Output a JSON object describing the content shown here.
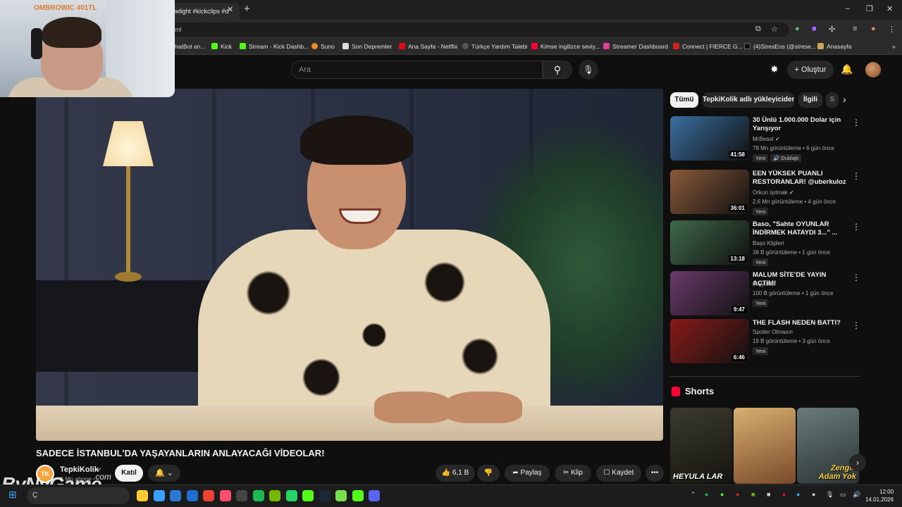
{
  "browser": {
    "tab_title": "wlight #kickclips #d",
    "tab_close": "✕",
    "new_tab": "+",
    "address": "ml",
    "window_controls": [
      "–",
      "❐",
      "✕"
    ],
    "bookmarks": [
      {
        "label": "hatBot an...",
        "color": "#444444"
      },
      {
        "label": "Kick",
        "color": "#53fc18"
      },
      {
        "label": "Stream - Kick Dashb...",
        "color": "#53fc18"
      },
      {
        "label": "Suno",
        "color": "#f08a24"
      },
      {
        "label": "Son Depremler",
        "color": "#dddddd"
      },
      {
        "label": "Ana Sayfa - Netflix",
        "color": "#e50914"
      },
      {
        "label": "Türkçe Yardım Talebi",
        "color": "#222222"
      },
      {
        "label": "Kimse ingilizce seviy...",
        "color": "#ff0033"
      },
      {
        "label": "Streamer Dashboard",
        "color": "#e0409a"
      },
      {
        "label": "Connect | FIERCE G...",
        "color": "#d4231f"
      },
      {
        "label": "(4)StresEos (@strese...",
        "color": "#111111"
      },
      {
        "label": "Anasayfa",
        "color": "#c8a85a"
      }
    ]
  },
  "webcam": {
    "label": "OMBROWIC 401TL"
  },
  "header": {
    "search_placeholder": "Ara",
    "search_icon": "search-icon",
    "mic_icon": "mic-icon",
    "create_label": "Oluştur",
    "create_icon": "+"
  },
  "video": {
    "title": "SADECE İSTANBUL'DA YAŞAYANLARIN ANLAYACAĞI VİDEOLAR!",
    "channel_name": "TepkiKolik",
    "channel_avatar_text": "TK",
    "channel_subs": "3 Mn abone",
    "join_label": "Katıl",
    "like_count": "6,1 B",
    "share_label": "Paylaş",
    "clip_label": "Klip",
    "save_label": "Kaydet",
    "more_label": "•••"
  },
  "watermark": {
    "main": "ByNyGame",
    "suffix": ".com"
  },
  "chips": [
    "Tümü",
    "TepkiKolik adlı yükleyiciden",
    "İlgili",
    "S"
  ],
  "recommendations": [
    {
      "title": "30 Ünlü 1.000.000 Dolar için Yarışıyor",
      "channel": "MrBeast",
      "verified": "✔",
      "meta": "78 Mn görüntüleme • 6 gün önce",
      "badge": "Yeni",
      "badge2": "🔊 Dublajlı",
      "duration": "41:58",
      "thumb_color": "#3a6fa0"
    },
    {
      "title": "EEN YÜKSEK PUANLI RESTORANLAR! @uberkuloz ...",
      "channel": "Orkun Işıtmak",
      "verified": "✔",
      "meta": "2,6 Mn görüntüleme • 4 gün önce",
      "badge": "Yeni",
      "badge2": "",
      "duration": "36:01",
      "thumb_color": "#8a5a3a"
    },
    {
      "title": "Baso, \"Sahte OYUNLAR İNDİRMEK HATAYDI 3...\" ...",
      "channel": "Başo Klipleri",
      "verified": "",
      "meta": "38 B görüntüleme • 1 gün önce",
      "badge": "Yeni",
      "badge2": "",
      "duration": "13:18",
      "thumb_color": "#3f6a4a"
    },
    {
      "title": "MALUM SİTE'DE YAYIN AÇTIM!",
      "channel": "Misyoner",
      "verified": "",
      "meta": "100 B görüntüleme • 1 gün önce",
      "badge": "Yeni",
      "badge2": "",
      "duration": "9:47",
      "thumb_color": "#6a3a6a"
    },
    {
      "title": "THE FLASH NEDEN BATTI?",
      "channel": "Spoiler Olmasın",
      "verified": "",
      "meta": "19 B görüntüleme • 3 gün önce",
      "badge": "Yeni",
      "badge2": "",
      "duration": "6:46",
      "thumb_color": "#8a1a1a"
    }
  ],
  "shorts": {
    "title": "Shorts",
    "items": [
      {
        "label": "HEYULA LAR",
        "color": "#2a2a22"
      },
      {
        "label": "",
        "color": "#a8804a"
      },
      {
        "label": "Zengin Adam Yok",
        "color": "#4a5a5a"
      }
    ]
  },
  "taskbar": {
    "search_text": "Ç",
    "clock_time": "12:00",
    "clock_date": "14.01.2026",
    "apps": [
      "#ffcc33",
      "#3aa0ff",
      "#2a7ad4",
      "#1f6fd1",
      "#ea4335",
      "#ff4d6d",
      "#444444",
      "#1db954",
      "#76b900",
      "#25d366",
      "#53fc18",
      "#1b2838",
      "#7bdc50",
      "#53fc18",
      "#5865f2"
    ]
  }
}
